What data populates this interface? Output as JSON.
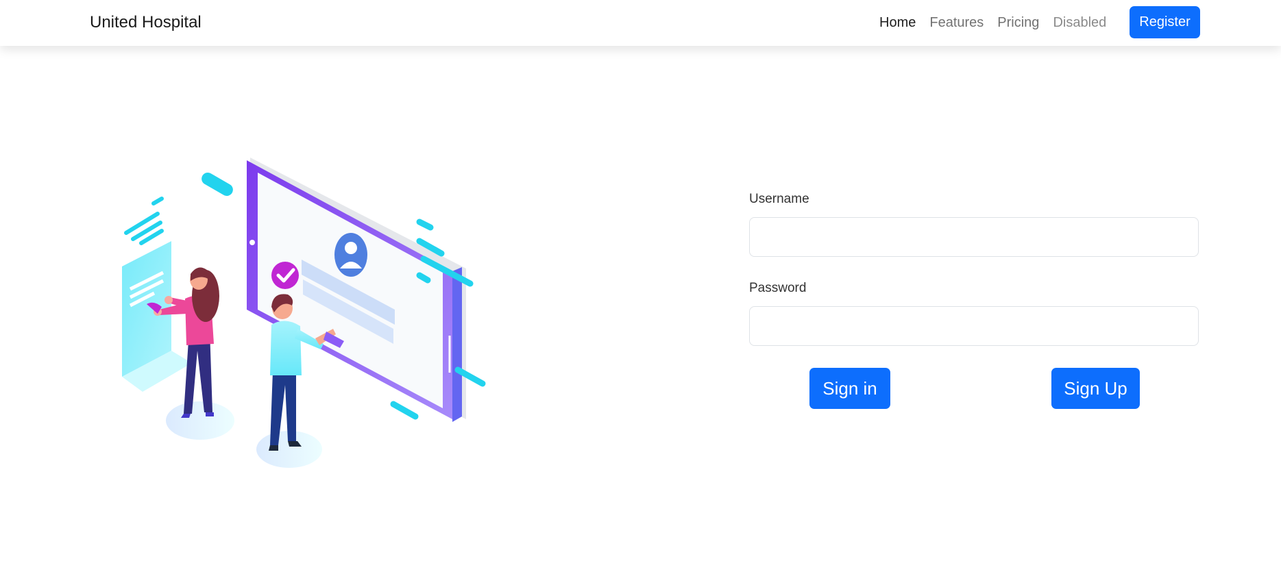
{
  "navbar": {
    "brand": "United Hospital",
    "links": [
      {
        "label": "Home",
        "state": "active"
      },
      {
        "label": "Features",
        "state": "normal"
      },
      {
        "label": "Pricing",
        "state": "normal"
      },
      {
        "label": "Disabled",
        "state": "disabled"
      }
    ],
    "register_label": "Register"
  },
  "login_form": {
    "username_label": "Username",
    "username_value": "",
    "password_label": "Password",
    "password_value": "",
    "signin_label": "Sign in",
    "signup_label": "Sign Up"
  },
  "colors": {
    "primary": "#0d6efd",
    "accent_purple": "#8b5cf6",
    "accent_cyan": "#22d3ee",
    "accent_pink": "#ec4899"
  },
  "illustration": {
    "icons": [
      "user-profile-icon",
      "check-badge-icon"
    ]
  }
}
